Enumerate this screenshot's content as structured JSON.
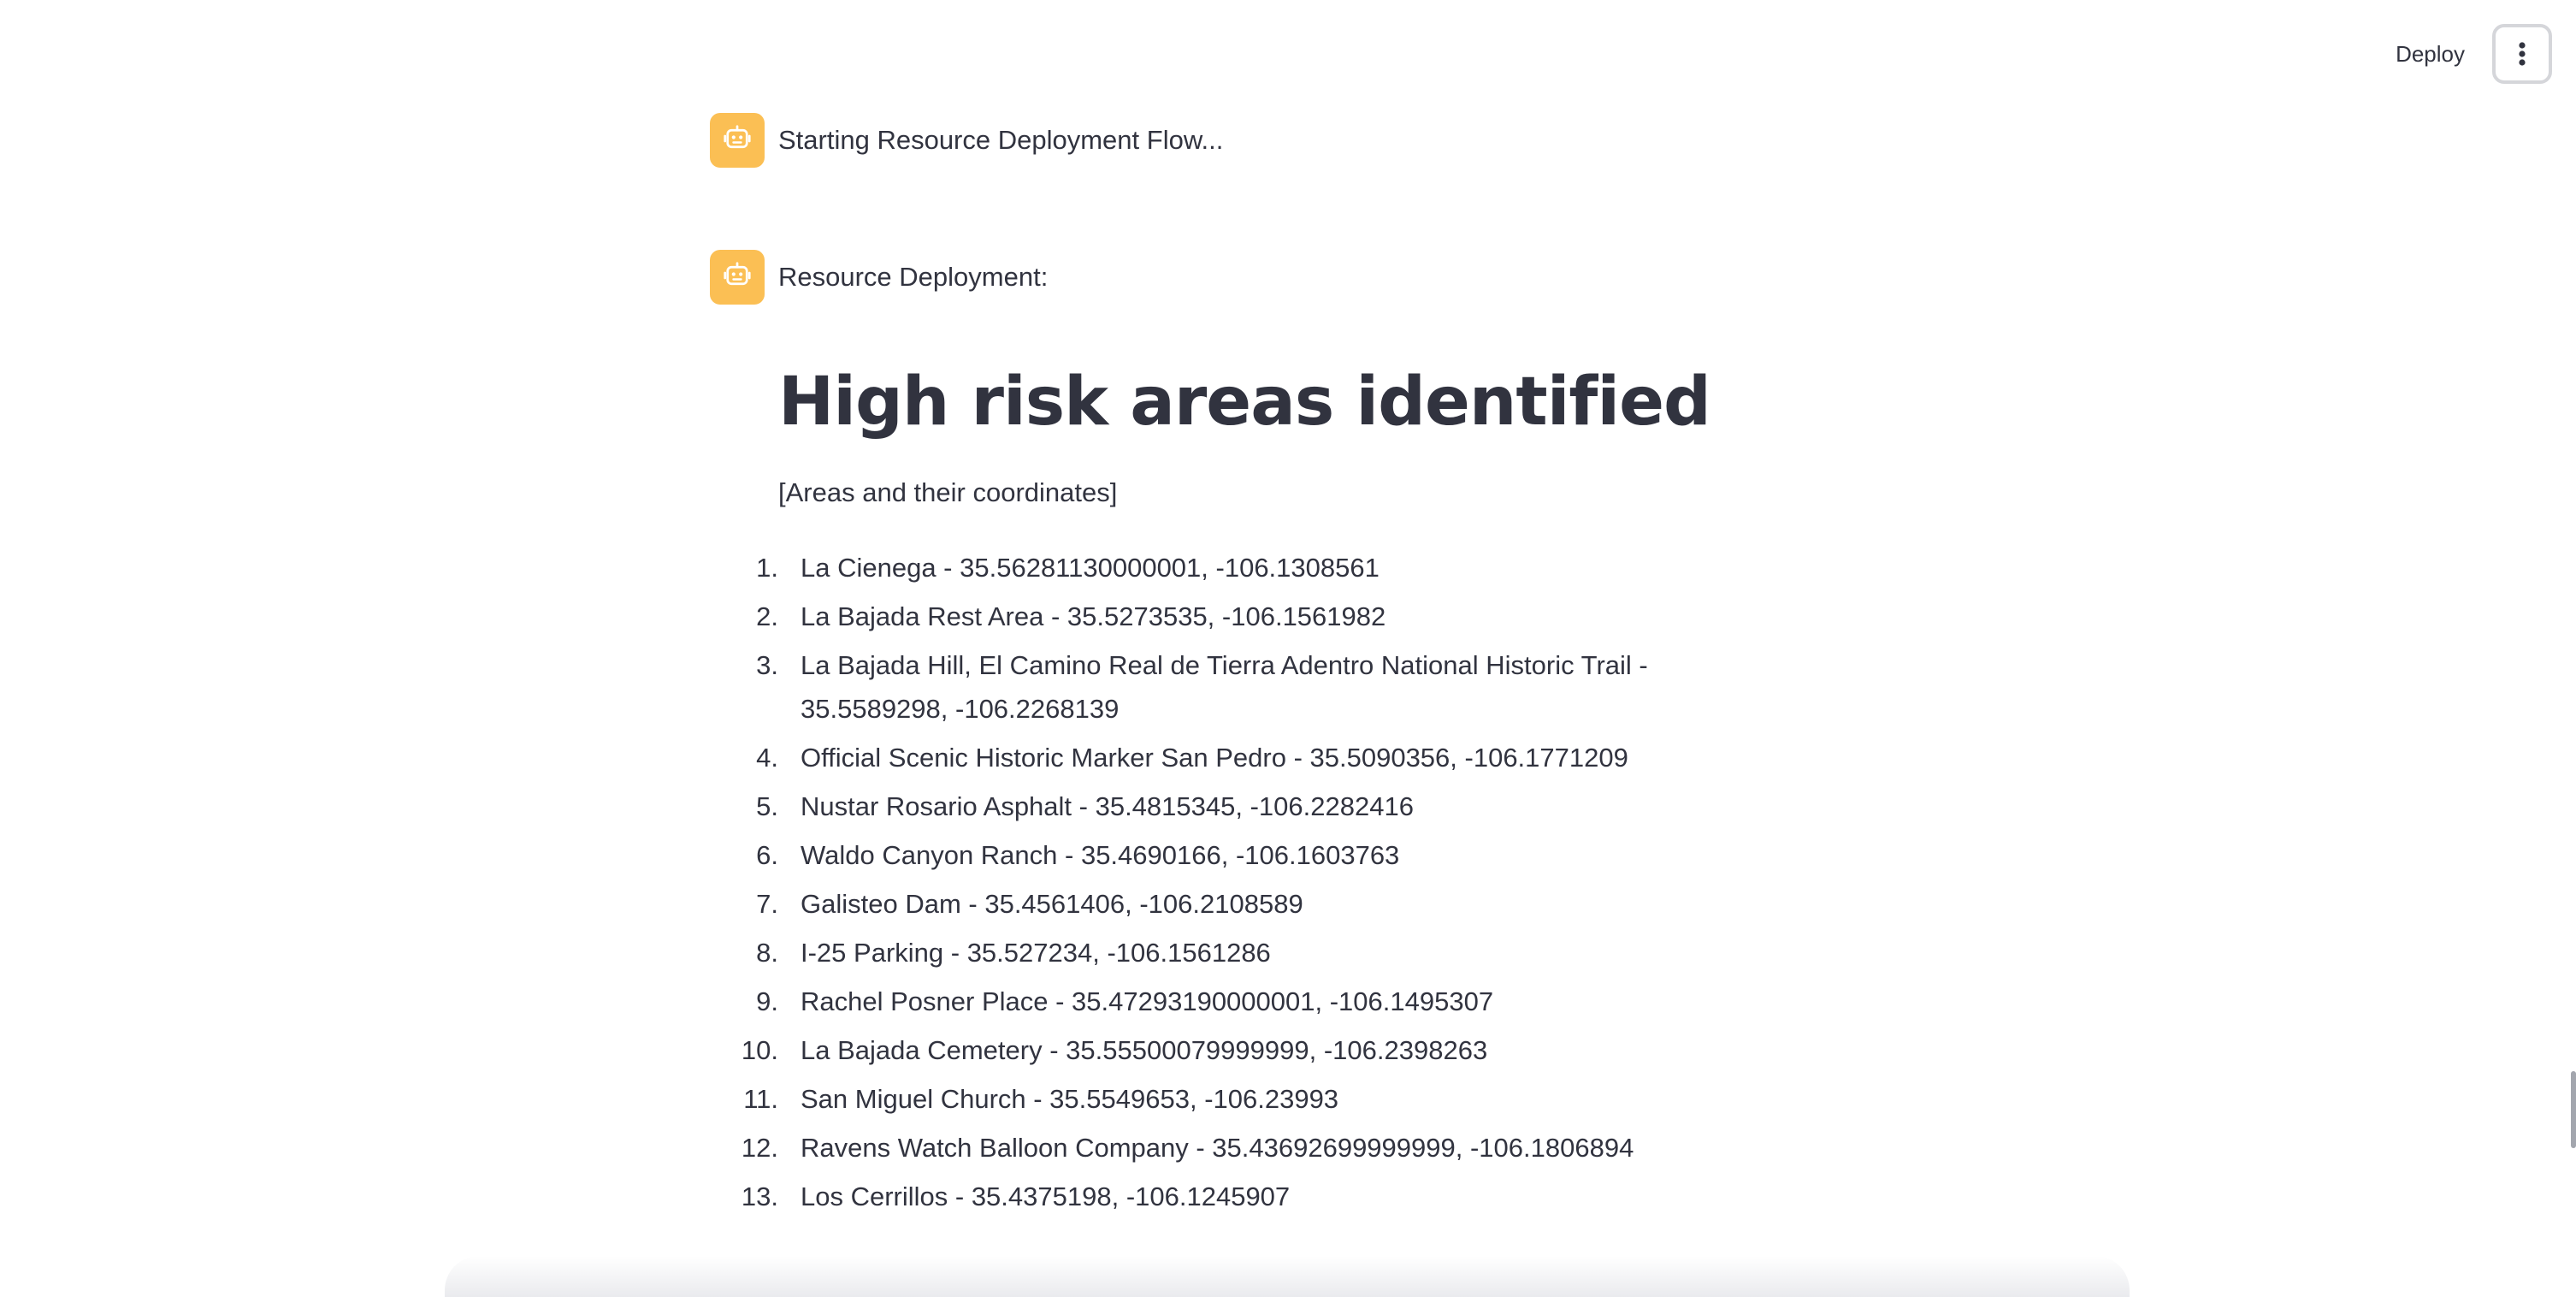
{
  "header": {
    "deploy_label": "Deploy",
    "menu_icon": "vertical-ellipsis-icon"
  },
  "messages": [
    {
      "avatar_icon": "robot-icon",
      "text": "Starting Resource Deployment Flow..."
    },
    {
      "avatar_icon": "robot-icon",
      "text": "Resource Deployment:"
    }
  ],
  "report": {
    "heading": "High risk areas identified",
    "subtitle": "[Areas and their coordinates]",
    "areas": [
      {
        "num": "1.",
        "text": "La Cienega - 35.56281130000001, -106.1308561"
      },
      {
        "num": "2.",
        "text": "La Bajada Rest Area - 35.5273535, -106.1561982"
      },
      {
        "num": "3.",
        "text": "La Bajada Hill, El Camino Real de Tierra Adentro National Historic Trail - 35.5589298, -106.2268139"
      },
      {
        "num": "4.",
        "text": "Official Scenic Historic Marker San Pedro - 35.5090356, -106.1771209"
      },
      {
        "num": "5.",
        "text": "Nustar Rosario Asphalt - 35.4815345, -106.2282416"
      },
      {
        "num": "6.",
        "text": "Waldo Canyon Ranch - 35.4690166, -106.1603763"
      },
      {
        "num": "7.",
        "text": "Galisteo Dam - 35.4561406, -106.2108589"
      },
      {
        "num": "8.",
        "text": "I-25 Parking - 35.527234, -106.1561286"
      },
      {
        "num": "9.",
        "text": "Rachel Posner Place - 35.47293190000001, -106.1495307"
      },
      {
        "num": "10.",
        "text": "La Bajada Cemetery - 35.55500079999999, -106.2398263"
      },
      {
        "num": "11.",
        "text": "San Miguel Church - 35.5549653, -106.23993"
      },
      {
        "num": "12.",
        "text": "Ravens Watch Balloon Company - 35.43692699999999, -106.1806894"
      },
      {
        "num": "13.",
        "text": "Los Cerrillos - 35.4375198, -106.1245907"
      }
    ]
  },
  "colors": {
    "avatar_bg": "#fbbf54",
    "text": "#31333f",
    "background": "#ffffff"
  }
}
